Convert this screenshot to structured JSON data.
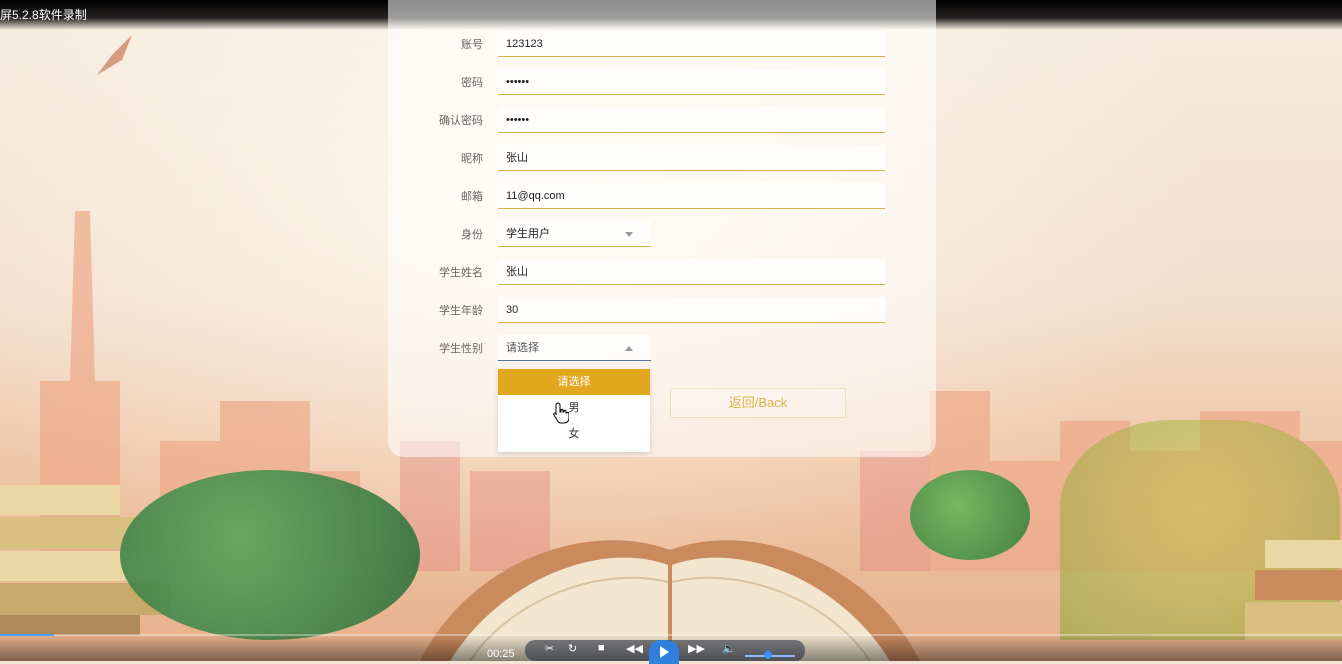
{
  "recorder": {
    "title": "屏5.2.8软件录制",
    "time": "00:25",
    "progress_fraction": 0.04,
    "volume_fraction": 0.45
  },
  "form": {
    "fields": [
      {
        "label": "账号",
        "value": "123123"
      },
      {
        "label": "密码",
        "value": "••••••"
      },
      {
        "label": "确认密码",
        "value": "••••••"
      },
      {
        "label": "昵称",
        "value": "张山"
      },
      {
        "label": "邮箱",
        "value": "11@qq.com"
      },
      {
        "label": "身份",
        "value": "学生用户"
      },
      {
        "label": "学生姓名",
        "value": "张山"
      },
      {
        "label": "学生年龄",
        "value": "30"
      },
      {
        "label": "学生性别",
        "value": "请选择"
      }
    ],
    "gender_options": [
      "请选择",
      "男",
      "女"
    ],
    "back_label": "返回/Back"
  },
  "colors": {
    "accent": "#e2a71f",
    "field_border": "#d8b24e",
    "back_text": "#e2b04a"
  }
}
